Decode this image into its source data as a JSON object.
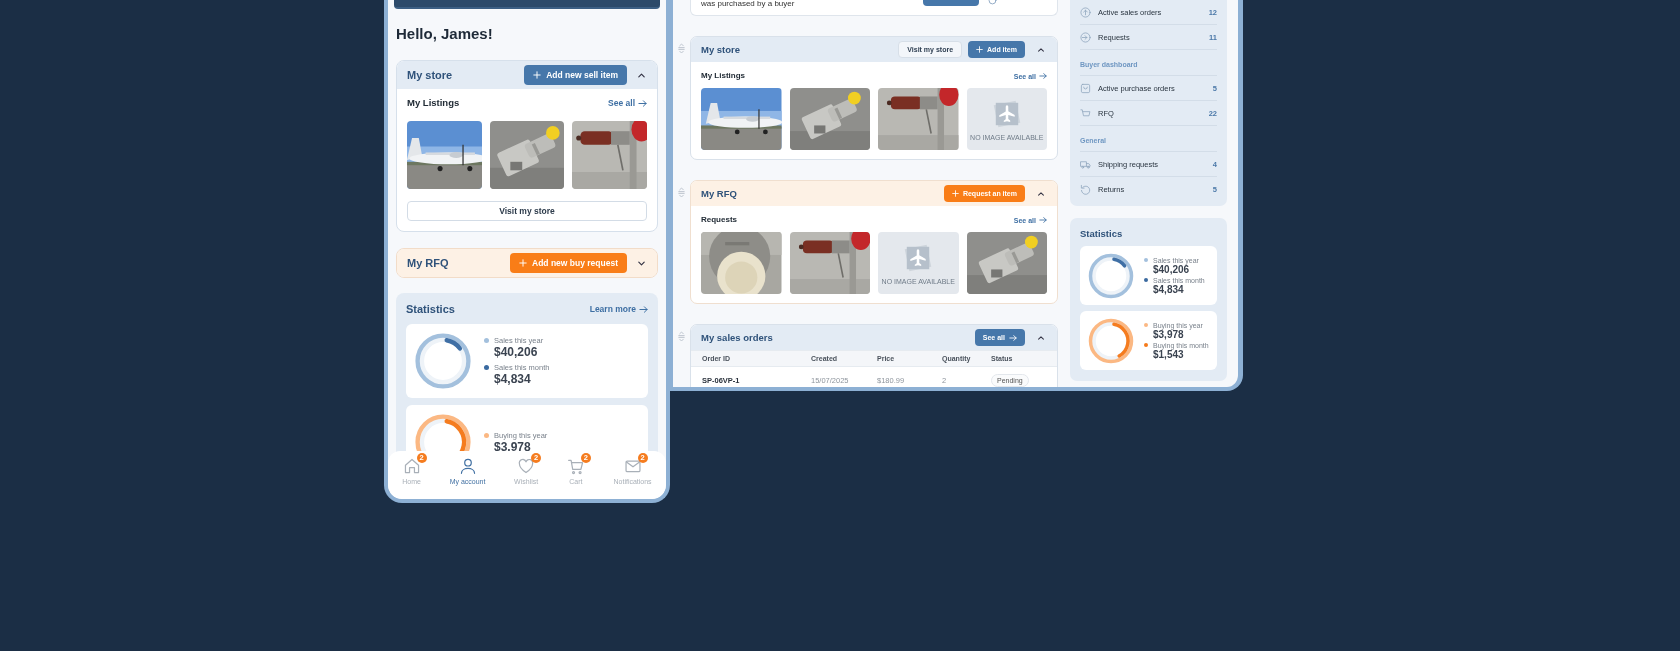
{
  "mobile": {
    "greeting": "Hello, James!",
    "store": {
      "title": "My store",
      "action": "Add new sell item",
      "expanded": true,
      "subtitle": "My Listings",
      "see_all": "See all",
      "items": [
        {
          "kind": "picture"
        },
        {
          "kind": "picture"
        },
        {
          "kind": "picture"
        }
      ],
      "footer_button": "Visit my store"
    },
    "rfq": {
      "title": "My RFQ",
      "action": "Add new buy request",
      "expanded": false
    },
    "statistics": {
      "title": "Statistics",
      "link": "Learn more",
      "cards": [
        {
          "color": "#3f6fa5",
          "level": 0.12,
          "items": [
            {
              "label": "Sales this year",
              "value": "$40,206",
              "color": "#a3c0dd"
            },
            {
              "label": "Sales this month",
              "value": "$4,834",
              "color": "#3a6aa0"
            }
          ]
        },
        {
          "color": "#f57c1f",
          "level": 0.39,
          "items": [
            {
              "label": "Buying this year",
              "value": "$3,978",
              "color": "#fbb883"
            }
          ]
        }
      ]
    },
    "nav": [
      {
        "label": "Home",
        "badge": "2",
        "selected": false
      },
      {
        "label": "My account",
        "selected": true
      },
      {
        "label": "Wishlist",
        "badge": "2",
        "selected": false
      },
      {
        "label": "Cart",
        "badge": "2",
        "selected": false
      },
      {
        "label": "Notifications",
        "badge": "2",
        "selected": false
      }
    ]
  },
  "desktop": {
    "notice": {
      "text": "was purchased by a buyer"
    },
    "panels": [
      {
        "kind": "gallery",
        "title": "My store",
        "expanded": true,
        "buttons": [
          {
            "kind": "outline",
            "label": "Visit my store"
          },
          {
            "kind": "add",
            "label": "Add item"
          }
        ],
        "subtitle": "My Listings",
        "see_all": "See all",
        "items": [
          {
            "kind": "picture"
          },
          {
            "kind": "picture"
          },
          {
            "kind": "picture"
          },
          {
            "kind": "placeholder",
            "text": "NO IMAGE AVAILABLE"
          }
        ]
      },
      {
        "kind": "gallery",
        "title": "My RFQ",
        "expanded": true,
        "buttons": [
          {
            "kind": "add",
            "label": "Request an item"
          }
        ],
        "subtitle": "Requests",
        "see_all": "See all",
        "items": [
          {
            "kind": "picture"
          },
          {
            "kind": "picture"
          },
          {
            "kind": "placeholder",
            "text": "NO IMAGE AVAILABLE"
          },
          {
            "kind": "picture"
          }
        ]
      },
      {
        "kind": "table",
        "title": "My sales orders",
        "expanded": true,
        "buttons": [
          {
            "kind": "arrow",
            "label": "See all"
          }
        ],
        "columns": [
          "Order ID",
          "Created",
          "Price",
          "Quantity",
          "Status"
        ],
        "rows": [
          {
            "order_id": "SP-06VP-1",
            "created": "15/07/2025",
            "price": "$180.99",
            "quantity": "2",
            "status": "Pending"
          }
        ]
      }
    ],
    "menu": [
      {
        "kind": "item",
        "label": "Active sales orders",
        "count": "12"
      },
      {
        "kind": "item",
        "label": "Requests",
        "count": "11"
      },
      {
        "kind": "heading",
        "label": "Buyer dashboard"
      },
      {
        "kind": "item",
        "label": "Active purchase orders",
        "count": "5"
      },
      {
        "kind": "item",
        "label": "RFQ",
        "count": "22"
      },
      {
        "kind": "heading",
        "label": "General"
      },
      {
        "kind": "item",
        "label": "Shipping requests",
        "count": "4"
      },
      {
        "kind": "item",
        "label": "Returns",
        "count": "5"
      }
    ],
    "statistics": {
      "title": "Statistics",
      "cards": [
        {
          "color": "#3f6fa5",
          "level": 0.12,
          "items": [
            {
              "label": "Sales this year",
              "value": "$40,206",
              "color": "#a3c0dd"
            },
            {
              "label": "Sales this month",
              "value": "$4,834",
              "color": "#3a6aa0"
            }
          ]
        },
        {
          "color": "#f57c1f",
          "level": 0.39,
          "items": [
            {
              "label": "Buying this year",
              "value": "$3,978",
              "color": "#fbb883"
            },
            {
              "label": "Buying this month",
              "value": "$1,543",
              "color": "#f57a1b"
            }
          ]
        }
      ]
    }
  }
}
